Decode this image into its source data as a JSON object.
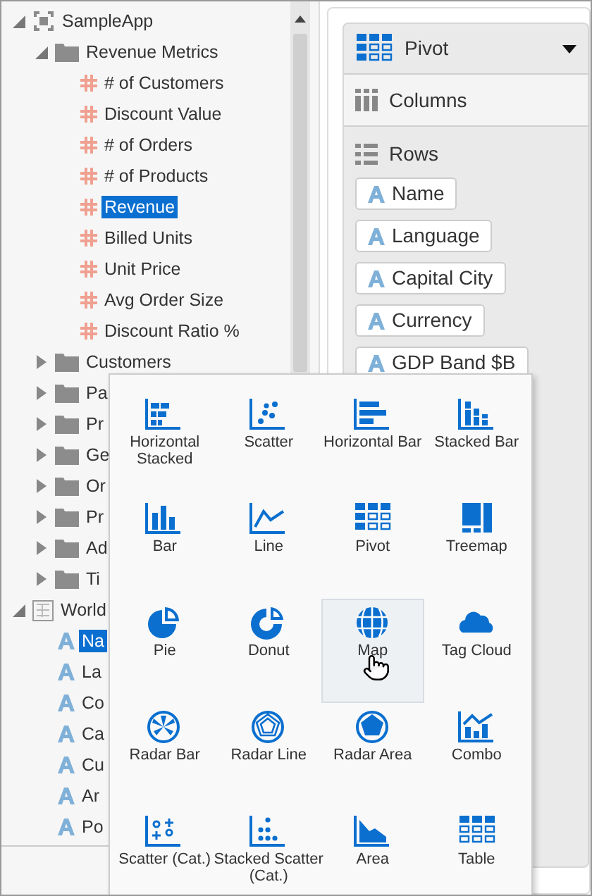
{
  "tree": [
    {
      "label": "SampleApp",
      "kind": "app",
      "expanded": true,
      "selected": false,
      "children": [
        {
          "label": "Revenue Metrics",
          "kind": "folder",
          "expanded": true,
          "selected": false,
          "children": [
            {
              "label": "# of Customers",
              "kind": "measure",
              "selected": false
            },
            {
              "label": "Discount Value",
              "kind": "measure",
              "selected": false
            },
            {
              "label": "# of Orders",
              "kind": "measure",
              "selected": false
            },
            {
              "label": "# of Products",
              "kind": "measure",
              "selected": false
            },
            {
              "label": "Revenue",
              "kind": "measure",
              "selected": true
            },
            {
              "label": "Billed Units",
              "kind": "measure",
              "selected": false
            },
            {
              "label": "Unit Price",
              "kind": "measure",
              "selected": false
            },
            {
              "label": "Avg Order Size",
              "kind": "measure",
              "selected": false
            },
            {
              "label": "Discount Ratio %",
              "kind": "measure",
              "selected": false
            }
          ]
        },
        {
          "label": "Customers",
          "kind": "folder",
          "expanded": false,
          "selected": false
        },
        {
          "label": "Pa",
          "kind": "folder",
          "expanded": false,
          "selected": false
        },
        {
          "label": "Pr",
          "kind": "folder",
          "expanded": false,
          "selected": false
        },
        {
          "label": "Ge",
          "kind": "folder",
          "expanded": false,
          "selected": false
        },
        {
          "label": "Or",
          "kind": "folder",
          "expanded": false,
          "selected": false
        },
        {
          "label": "Pr",
          "kind": "folder",
          "expanded": false,
          "selected": false
        },
        {
          "label": "Ad",
          "kind": "folder",
          "expanded": false,
          "selected": false
        },
        {
          "label": "Ti",
          "kind": "folder",
          "expanded": false,
          "selected": false
        }
      ]
    },
    {
      "label": "World",
      "kind": "table",
      "expanded": true,
      "selected": false,
      "children": [
        {
          "label": "Na",
          "kind": "attribute",
          "selected": true
        },
        {
          "label": "La",
          "kind": "attribute",
          "selected": false
        },
        {
          "label": "Co",
          "kind": "attribute",
          "selected": false
        },
        {
          "label": "Ca",
          "kind": "attribute",
          "selected": false
        },
        {
          "label": "Cu",
          "kind": "attribute",
          "selected": false
        },
        {
          "label": "Ar",
          "kind": "attribute",
          "selected": false
        },
        {
          "label": "Po",
          "kind": "attribute",
          "selected": false
        }
      ]
    }
  ],
  "pivot": {
    "title": "Pivot",
    "columns_label": "Columns",
    "rows_label": "Rows",
    "rows": [
      "Name",
      "Language",
      "Capital City",
      "Currency",
      "GDP Band $B"
    ]
  },
  "chart_types": [
    {
      "label": "Horizontal Stacked",
      "kind": "hstacked",
      "hovered": false
    },
    {
      "label": "Scatter",
      "kind": "scatter",
      "hovered": false
    },
    {
      "label": "Horizontal Bar",
      "kind": "hbar",
      "hovered": false
    },
    {
      "label": "Stacked Bar",
      "kind": "stackedbar",
      "hovered": false
    },
    {
      "label": "Bar",
      "kind": "bar",
      "hovered": false
    },
    {
      "label": "Line",
      "kind": "line",
      "hovered": false
    },
    {
      "label": "Pivot",
      "kind": "pivot",
      "hovered": false
    },
    {
      "label": "Treemap",
      "kind": "treemap",
      "hovered": false
    },
    {
      "label": "Pie",
      "kind": "pie",
      "hovered": false
    },
    {
      "label": "Donut",
      "kind": "donut",
      "hovered": false
    },
    {
      "label": "Map",
      "kind": "map",
      "hovered": true
    },
    {
      "label": "Tag Cloud",
      "kind": "tagcloud",
      "hovered": false
    },
    {
      "label": "Radar Bar",
      "kind": "radarbar",
      "hovered": false
    },
    {
      "label": "Radar Line",
      "kind": "radarline",
      "hovered": false
    },
    {
      "label": "Radar Area",
      "kind": "radararea",
      "hovered": false
    },
    {
      "label": "Combo",
      "kind": "combo",
      "hovered": false
    },
    {
      "label": "Scatter (Cat.)",
      "kind": "scattercat",
      "hovered": false
    },
    {
      "label": "Stacked Scatter (Cat.)",
      "kind": "stackedscattercat",
      "hovered": false
    },
    {
      "label": "Area",
      "kind": "area",
      "hovered": false
    },
    {
      "label": "Table",
      "kind": "table",
      "hovered": false
    }
  ]
}
